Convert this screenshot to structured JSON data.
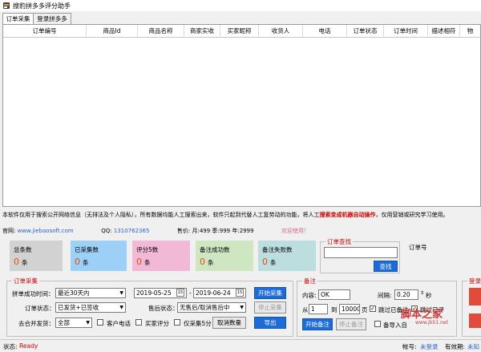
{
  "window": {
    "title": "搜豹拼多多评分助手"
  },
  "tabs": [
    "订单采集",
    "登录拼多多"
  ],
  "grid": {
    "columns": [
      "订单编号",
      "商品Id",
      "商品名称",
      "商家实收",
      "买家昵称",
      "收货人",
      "电话",
      "订单状态",
      "订单时间",
      "描述相符",
      "物"
    ]
  },
  "notice": {
    "text_before": "本软件仅用于搜索公开网络信息（无排法及个人隐私），所有数据均能人工搜索出来，软件只起到代替人工复劳动的功能，将人工",
    "highlight": "搜索变成机器自动操作",
    "text_after": "，仅用营销或研究学习使用。"
  },
  "links": {
    "website_label": "官网:",
    "website": "www.jiebaosoft.com",
    "qq_label": "QQ:",
    "qq": "1310762365",
    "price": "售价: 月:499 季:999 年:2999",
    "welcome": "欢迎使用！"
  },
  "stats": [
    {
      "label": "总条数",
      "value": "0",
      "unit": "条",
      "color": "#d2d2d2"
    },
    {
      "label": "已采集数",
      "value": "0",
      "unit": "条",
      "color": "#9dd0f7"
    },
    {
      "label": "评分5数",
      "value": "0",
      "unit": "条",
      "color": "#f2b9d7"
    },
    {
      "label": "备注成功数",
      "value": "0",
      "unit": "条",
      "color": "#cfe6c2"
    },
    {
      "label": "备注失败数",
      "value": "0",
      "unit": "条",
      "color": "#bcdede"
    }
  ],
  "order_query": {
    "title": "订单查找",
    "button": "查找",
    "label": "订单号"
  },
  "collect": {
    "title": "订单采集",
    "period_label": "拼单成功时间：",
    "period_value": "最近30天内",
    "date_from": "2019-05-25",
    "date_to": "2019-06-24",
    "date_sep": "-",
    "start_button": "开始采集",
    "status_label": "订单状态：",
    "status_value": "已发货+已签收",
    "aftersale_label": "售后状态：",
    "aftersale_value": "无售后/取消售后中",
    "stop_button": "停止采集",
    "merge_label": "去合并发货：",
    "merge_value": "全部",
    "chk_phone": "客户电话",
    "chk_buyer": "买家评分",
    "chk_five": "仅采集5分",
    "cancel_button": "取消数量",
    "export_button": "导出"
  },
  "remark": {
    "title": "备注",
    "content_label": "内容:",
    "content_value": "OK",
    "interval_label": "间隔:",
    "interval_value": "0.20",
    "interval_unit": "秒",
    "from_label": "从",
    "from_value": "1",
    "to_label": "到",
    "to_value": "10000",
    "page_label": "页",
    "skip_remarked": "跳过已备注",
    "skip_rated": "跳过已评",
    "start_button": "开始备注",
    "stop_button": "停止备注",
    "import_label": "备导入自"
  },
  "login": {
    "title": "登录"
  },
  "status": {
    "label": "状态:",
    "value": "Ready",
    "account_label": "帐号:",
    "account_value": "未登录",
    "validity_label": "有效期:",
    "validity_value": "未知"
  },
  "watermark": {
    "cn": "脚本之家",
    "url": "www.jb51.net"
  }
}
